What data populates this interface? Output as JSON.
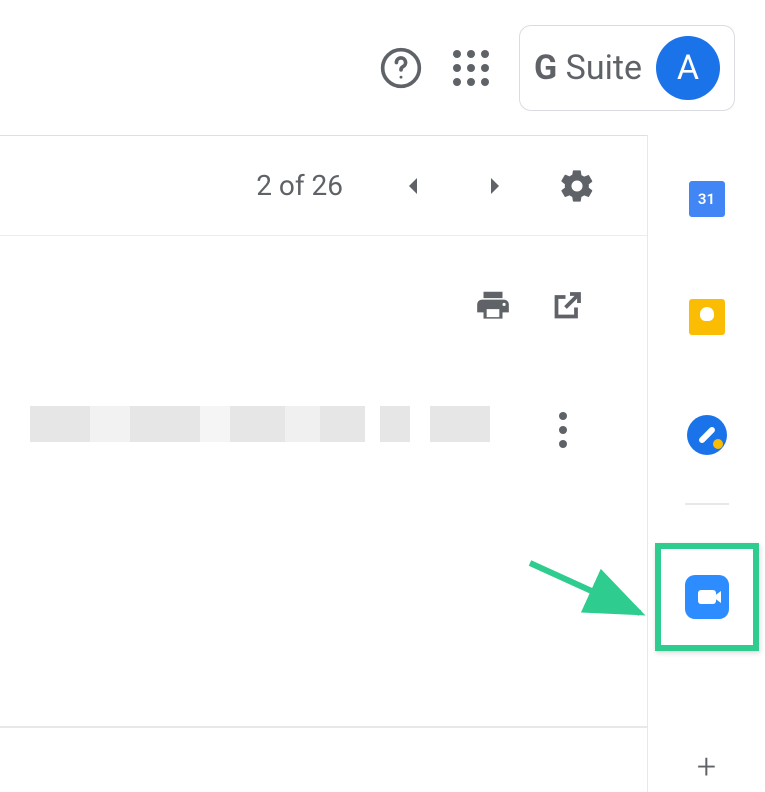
{
  "header": {
    "suite_label_g": "G",
    "suite_label_suite": " Suite",
    "avatar_initial": "A"
  },
  "toolbar": {
    "pagination_text": "2 of 26"
  },
  "side_panel": {
    "calendar_day": "31"
  },
  "colors": {
    "accent_blue": "#1a73e8",
    "highlight_green": "#2ecc8f",
    "zoom_blue": "#2d8cff",
    "keep_yellow": "#fbbc04",
    "icon_gray": "#5f6368"
  }
}
